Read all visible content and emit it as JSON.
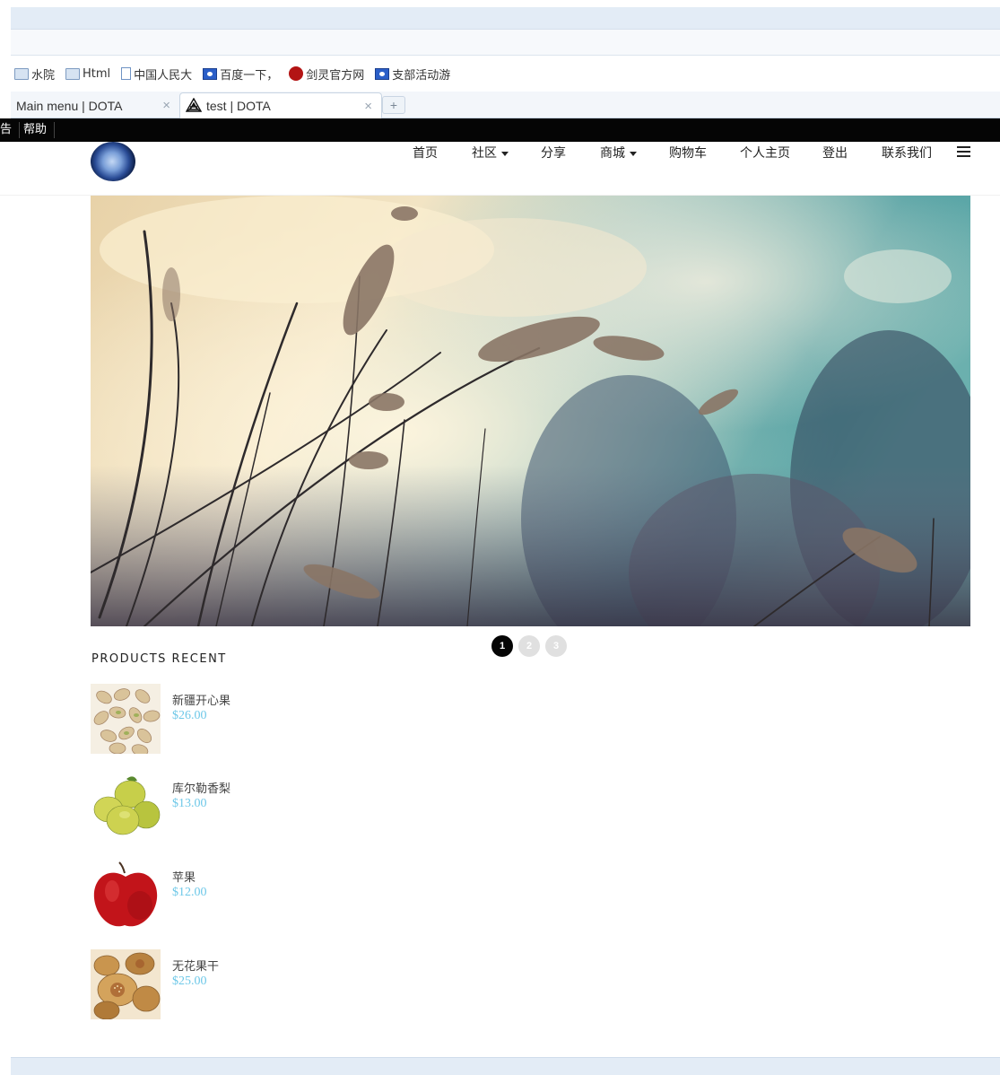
{
  "browser": {
    "bookmarks": [
      {
        "label": "水院",
        "icon": "folder-icon"
      },
      {
        "label": "Html",
        "icon": "folder-icon"
      },
      {
        "label": "中国人民大",
        "icon": "page-icon"
      },
      {
        "label": "百度一下，",
        "icon": "baidu-paw-icon"
      },
      {
        "label": "剑灵官方网",
        "icon": "bug-icon"
      },
      {
        "label": "支部活动游",
        "icon": "baidu-paw-icon"
      }
    ],
    "tabs": [
      {
        "label": "Main menu | DOTA",
        "active": false
      },
      {
        "label": "test | DOTA",
        "active": true
      }
    ],
    "close_glyph": "×",
    "newtab_glyph": "+"
  },
  "adminbar": {
    "items": [
      "告",
      "帮助"
    ]
  },
  "nav": {
    "items": [
      {
        "label": "首页",
        "dropdown": false
      },
      {
        "label": "社区",
        "dropdown": true
      },
      {
        "label": "分享",
        "dropdown": false
      },
      {
        "label": "商城",
        "dropdown": true
      },
      {
        "label": "购物车",
        "dropdown": false
      },
      {
        "label": "个人主页",
        "dropdown": false
      },
      {
        "label": "登出",
        "dropdown": false
      },
      {
        "label": "联系我们",
        "dropdown": false
      }
    ]
  },
  "slider": {
    "pages": [
      "1",
      "2",
      "3"
    ],
    "active_index": 0
  },
  "products": {
    "title": "PRODUCTS RECENT",
    "items": [
      {
        "name": "新疆开心果",
        "price": "$26.00"
      },
      {
        "name": "库尔勒香梨",
        "price": "$13.00"
      },
      {
        "name": "苹果",
        "price": "$12.00"
      },
      {
        "name": "无花果干",
        "price": "$25.00"
      }
    ]
  },
  "colors": {
    "price": "#6ec8e8",
    "adminbar": "#050505",
    "chrome": "#e3ecf6"
  }
}
